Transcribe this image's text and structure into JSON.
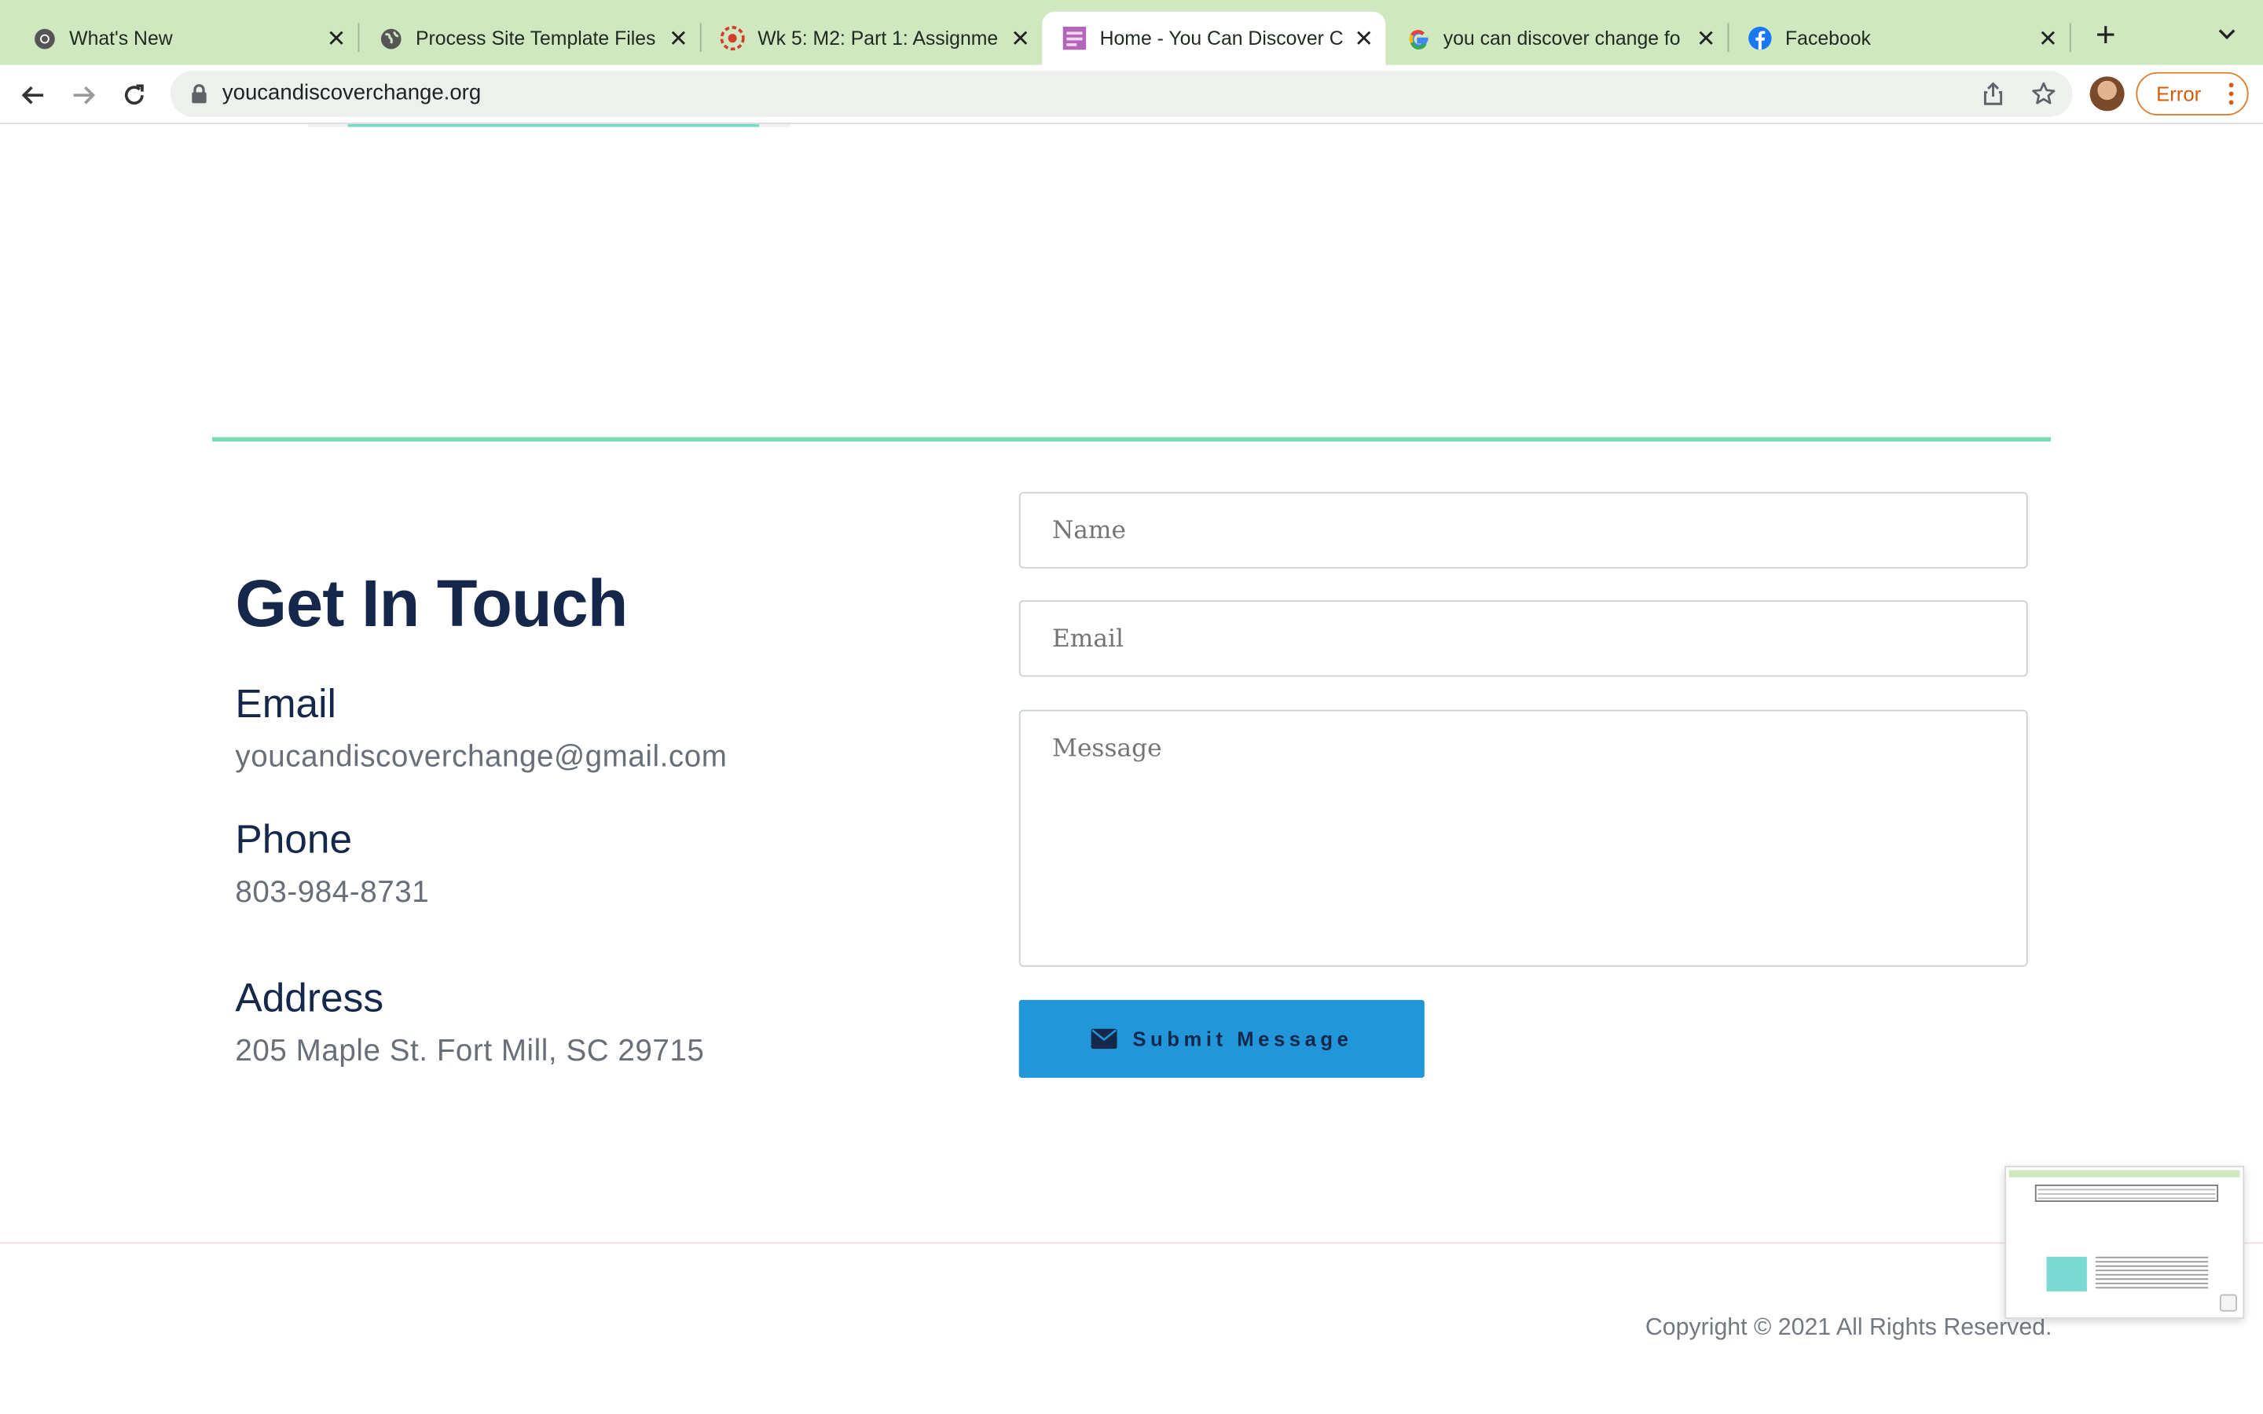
{
  "browser": {
    "tabs": [
      {
        "title": "What's New",
        "icon": "chrome-icon",
        "active": false
      },
      {
        "title": "Process Site Template Files",
        "icon": "globe-icon",
        "active": false
      },
      {
        "title": "Wk 5: M2: Part 1: Assignme",
        "icon": "canvas-icon",
        "active": false
      },
      {
        "title": "Home - You Can Discover C",
        "icon": "site-favicon",
        "active": true
      },
      {
        "title": "you can discover change fo",
        "icon": "google-icon",
        "active": false
      },
      {
        "title": "Facebook",
        "icon": "facebook-icon",
        "active": false
      }
    ],
    "url": "youcandiscoverchange.org",
    "profile_button": "Error"
  },
  "contact": {
    "title": "Get In Touch",
    "email_label": "Email",
    "email_value": "youcandiscoverchange@gmail.com",
    "phone_label": "Phone",
    "phone_value": "803-984-8731",
    "address_label": "Address",
    "address_value": "205 Maple St. Fort Mill, SC 29715"
  },
  "form": {
    "name_placeholder": "Name",
    "email_placeholder": "Email",
    "message_placeholder": "Message",
    "submit_label": "Submit Message"
  },
  "footer": {
    "copyright": "Copyright © 2021 All Rights Reserved."
  },
  "colors": {
    "tabstrip": "#cfe8c0",
    "heading": "#15284b",
    "accent_line": "#76dcb4",
    "submit_button": "#2196d9",
    "error_pill": "#e07d2c"
  }
}
